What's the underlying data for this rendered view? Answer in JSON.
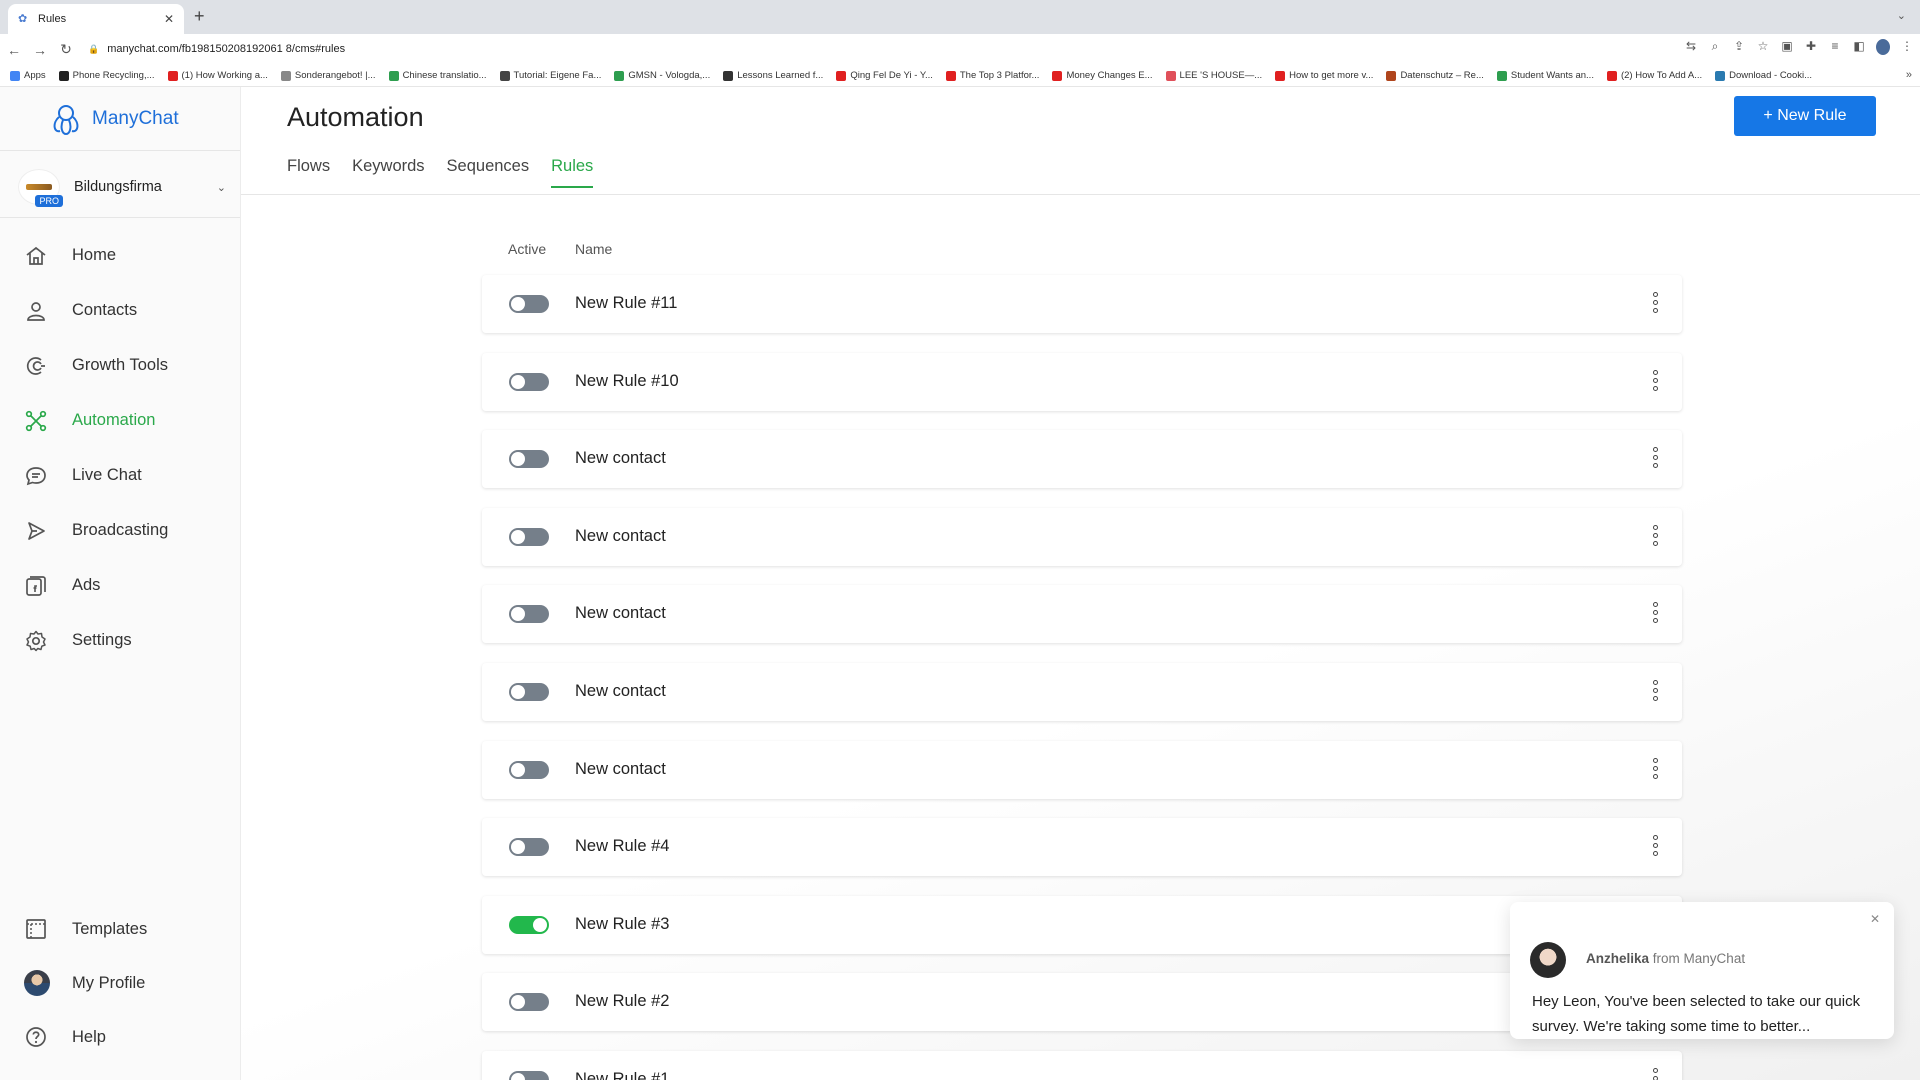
{
  "browser": {
    "tab_title": "Rules",
    "new_tab": "+",
    "url": "manychat.com/fb198150208192061 8/cms#rules",
    "bookmarks": [
      {
        "label": "Apps",
        "color": "#4285f4"
      },
      {
        "label": "Phone Recycling,...",
        "color": "#222222"
      },
      {
        "label": "(1) How Working a...",
        "color": "#e02020"
      },
      {
        "label": "Sonderangebot! |...",
        "color": "#888888"
      },
      {
        "label": "Chinese translatio...",
        "color": "#2e9e4f"
      },
      {
        "label": "Tutorial: Eigene Fa...",
        "color": "#444444"
      },
      {
        "label": "GMSN - Vologda,...",
        "color": "#2e9e4f"
      },
      {
        "label": "Lessons Learned f...",
        "color": "#333333"
      },
      {
        "label": "Qing Fel De Yi - Y...",
        "color": "#e02020"
      },
      {
        "label": "The Top 3 Platfor...",
        "color": "#e02020"
      },
      {
        "label": "Money Changes E...",
        "color": "#e02020"
      },
      {
        "label": "LEE 'S HOUSE—...",
        "color": "#e0505a"
      },
      {
        "label": "How to get more v...",
        "color": "#e02020"
      },
      {
        "label": "Datenschutz – Re...",
        "color": "#b0451c"
      },
      {
        "label": "Student Wants an...",
        "color": "#2e9e4f"
      },
      {
        "label": "(2) How To Add A...",
        "color": "#e02020"
      },
      {
        "label": "Download - Cooki...",
        "color": "#2a7ab0"
      }
    ]
  },
  "brand": {
    "name": "ManyChat",
    "color": "#1e6fd9"
  },
  "account": {
    "name": "Bildungsfirma",
    "badge": "PRO"
  },
  "nav": {
    "items": [
      {
        "label": "Home",
        "icon": "home-icon"
      },
      {
        "label": "Contacts",
        "icon": "contacts-icon"
      },
      {
        "label": "Growth Tools",
        "icon": "growth-tools-icon"
      },
      {
        "label": "Automation",
        "icon": "automation-icon",
        "active": true
      },
      {
        "label": "Live Chat",
        "icon": "live-chat-icon"
      },
      {
        "label": "Broadcasting",
        "icon": "broadcasting-icon"
      },
      {
        "label": "Ads",
        "icon": "ads-icon"
      },
      {
        "label": "Settings",
        "icon": "settings-icon"
      }
    ],
    "bottom": [
      {
        "label": "Templates",
        "icon": "templates-icon"
      },
      {
        "label": "My Profile",
        "icon": "profile-avatar"
      },
      {
        "label": "Help",
        "icon": "help-icon"
      }
    ]
  },
  "page": {
    "title": "Automation",
    "new_rule_label": "+ New Rule",
    "tabs": [
      {
        "label": "Flows"
      },
      {
        "label": "Keywords"
      },
      {
        "label": "Sequences"
      },
      {
        "label": "Rules",
        "active": true
      }
    ],
    "columns": {
      "active": "Active",
      "name": "Name"
    },
    "rules": [
      {
        "name": "New Rule #11",
        "active": false
      },
      {
        "name": "New Rule #10",
        "active": false
      },
      {
        "name": "New contact",
        "active": false
      },
      {
        "name": "New contact",
        "active": false
      },
      {
        "name": "New contact",
        "active": false
      },
      {
        "name": "New contact",
        "active": false
      },
      {
        "name": "New contact",
        "active": false
      },
      {
        "name": "New Rule #4",
        "active": false
      },
      {
        "name": "New Rule #3",
        "active": true
      },
      {
        "name": "New Rule #2",
        "active": false
      },
      {
        "name": "New Rule #1",
        "active": false
      }
    ]
  },
  "chat": {
    "sender": "Anzhelika",
    "from_label": "from ManyChat",
    "message": "Hey Leon,  You've been selected to take our quick survey. We're taking some time to better..."
  },
  "colors": {
    "accent_green": "#2aa84a",
    "primary_blue": "#1677e6",
    "toggle_off": "#757f8a",
    "toggle_on": "#22b84c"
  }
}
